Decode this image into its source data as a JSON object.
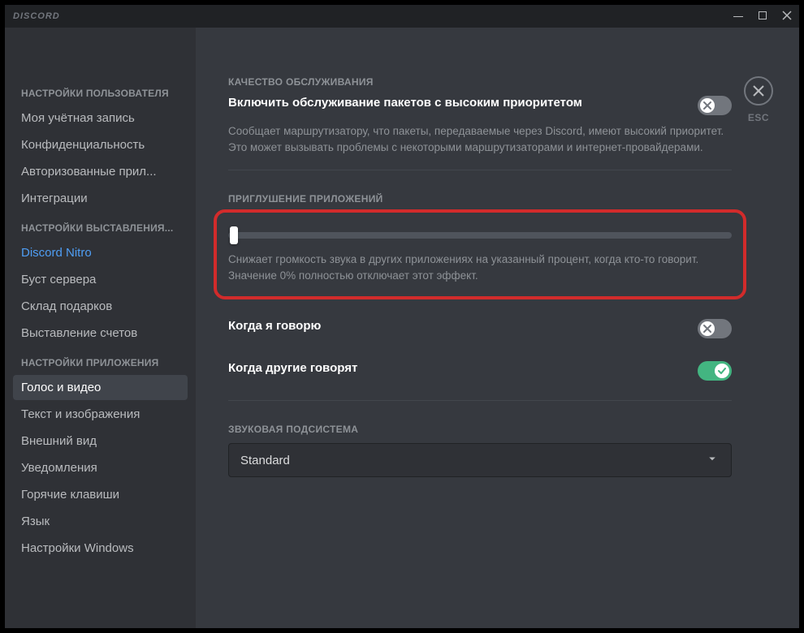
{
  "titlebar": {
    "brand": "DISCORD"
  },
  "close": {
    "esc": "ESC"
  },
  "sidebar": {
    "headers": {
      "user": "НАСТРОЙКИ ПОЛЬЗОВАТЕЛЯ",
      "billing": "НАСТРОЙКИ ВЫСТАВЛЕНИЯ...",
      "app": "НАСТРОЙКИ ПРИЛОЖЕНИЯ"
    },
    "items": {
      "account": "Моя учётная запись",
      "privacy": "Конфиденциальность",
      "authorized": "Авторизованные прил...",
      "integrations": "Интеграции",
      "nitro": "Discord Nitro",
      "boost": "Буст сервера",
      "gifts": "Склад подарков",
      "billing": "Выставление счетов",
      "voice": "Голос и видео",
      "text_images": "Текст и изображения",
      "appearance": "Внешний вид",
      "notifications": "Уведомления",
      "keybinds": "Горячие клавиши",
      "language": "Язык",
      "windows": "Настройки Windows"
    }
  },
  "qos": {
    "header": "КАЧЕСТВО ОБСЛУЖИВАНИЯ",
    "toggle_label": "Включить обслуживание пакетов с высоким приоритетом",
    "desc": "Сообщает маршрутизатору, что пакеты, передаваемые через Discord, имеют высокий приоритет. Это может вызывать проблемы с некоторыми маршрутизаторами и интернет-провайдерами."
  },
  "attenuation": {
    "header": "ПРИГЛУШЕНИЕ ПРИЛОЖЕНИЙ",
    "desc": "Снижает громкость звука в других приложениях на указанный процент, когда кто-то говорит. Значение 0% полностью отключает этот эффект.",
    "slider_value": 0,
    "when_i_speak": "Когда я говорю",
    "when_others_speak": "Когда другие говорят"
  },
  "audio_subsystem": {
    "header": "ЗВУКОВАЯ ПОДСИСТЕМА",
    "value": "Standard"
  },
  "toggles": {
    "qos": false,
    "when_i_speak": false,
    "when_others_speak": true
  }
}
